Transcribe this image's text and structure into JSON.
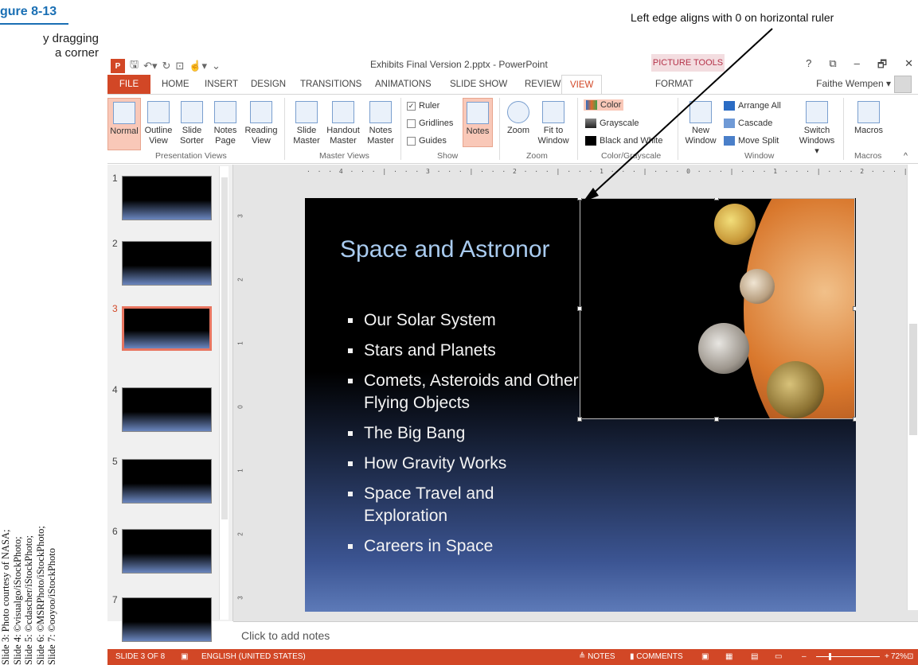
{
  "figure": {
    "number": "gure 8-13",
    "caption_line1": "y dragging",
    "caption_line2": "a corner",
    "callout": "Left edge aligns with 0 on horizontal ruler",
    "credits": [
      "Slide 3: Photo courtesy of NASA;",
      "Slide 4: ©visualgo/iStockPhoto;",
      "Slide 5: ©cdascher/iStockPhoto;",
      "Slide 6: ©MSRPhoto/iStockPhoto;",
      "Slide 7: ©ooyoo/iStockPhoto"
    ]
  },
  "window": {
    "doc_title": "Exhibits Final Version 2.pptx - PowerPoint",
    "contextual_tab": "PICTURE TOOLS",
    "controls": [
      "?",
      "⧉",
      "–",
      "🗗",
      "✕"
    ]
  },
  "tabs": [
    "FILE",
    "HOME",
    "INSERT",
    "DESIGN",
    "TRANSITIONS",
    "ANIMATIONS",
    "SLIDE SHOW",
    "REVIEW",
    "VIEW",
    "FORMAT"
  ],
  "active_tab": "VIEW",
  "user": "Faithe Wempen ▾",
  "ribbon": {
    "presentation_views": {
      "buttons": [
        {
          "line1": "Normal",
          "line2": ""
        },
        {
          "line1": "Outline",
          "line2": "View"
        },
        {
          "line1": "Slide",
          "line2": "Sorter"
        },
        {
          "line1": "Notes",
          "line2": "Page"
        },
        {
          "line1": "Reading",
          "line2": "View"
        }
      ],
      "label": "Presentation Views"
    },
    "master_views": {
      "buttons": [
        {
          "line1": "Slide",
          "line2": "Master"
        },
        {
          "line1": "Handout",
          "line2": "Master"
        },
        {
          "line1": "Notes",
          "line2": "Master"
        }
      ],
      "label": "Master Views"
    },
    "show": {
      "ruler": "Ruler",
      "gridlines": "Gridlines",
      "guides": "Guides",
      "notes": "Notes",
      "label": "Show"
    },
    "zoom": {
      "zoom": "Zoom",
      "fit_line1": "Fit to",
      "fit_line2": "Window",
      "label": "Zoom"
    },
    "color": {
      "color": "Color",
      "grayscale": "Grayscale",
      "bw": "Black and White",
      "label": "Color/Grayscale"
    },
    "window": {
      "new_line1": "New",
      "new_line2": "Window",
      "arrange": "Arrange All",
      "cascade": "Cascade",
      "move_split": "Move Split",
      "switch_line1": "Switch",
      "switch_line2": "Windows ▾",
      "label": "Window"
    },
    "macros": {
      "button": "Macros",
      "label": "Macros"
    }
  },
  "ruler_text": "· · · 4 · · · | · · · 3 · · · | · · · 2 · · · | · · · 1 · · · | · · · 0 · · · | · · · 1 · · · | · · · 2 · · · | · · · 3 · · · | · · · 4 · · ·",
  "vruler_labels": [
    "3",
    "2",
    "1",
    "0",
    "1",
    "2",
    "3"
  ],
  "thumbnails": [
    {
      "num": "1",
      "title": "",
      "selected": false
    },
    {
      "num": "2",
      "title": "",
      "selected": false
    },
    {
      "num": "3",
      "title": "",
      "selected": true
    },
    {
      "num": "4",
      "title": "",
      "selected": false
    },
    {
      "num": "5",
      "title": "",
      "selected": false
    },
    {
      "num": "6",
      "title": "",
      "selected": false
    },
    {
      "num": "7",
      "title": "",
      "selected": false
    }
  ],
  "slide": {
    "title": "Space and Astronor",
    "bullets": [
      "Our Solar System",
      "Stars and Planets",
      "Comets, Asteroids and Other Flying Objects",
      "The Big Bang",
      "How Gravity Works",
      "Space Travel and Exploration",
      "Careers in Space"
    ]
  },
  "notes_placeholder": "Click to add notes",
  "status": {
    "slide": "SLIDE 3 OF 8",
    "language": "ENGLISH (UNITED STATES)",
    "notes": "≜ NOTES",
    "comments": "▮ COMMENTS",
    "zoom": "72%"
  },
  "colors": {
    "accent": "#d24726",
    "slide_title": "#a9cbef",
    "figure_blue": "#1a6fb4"
  }
}
